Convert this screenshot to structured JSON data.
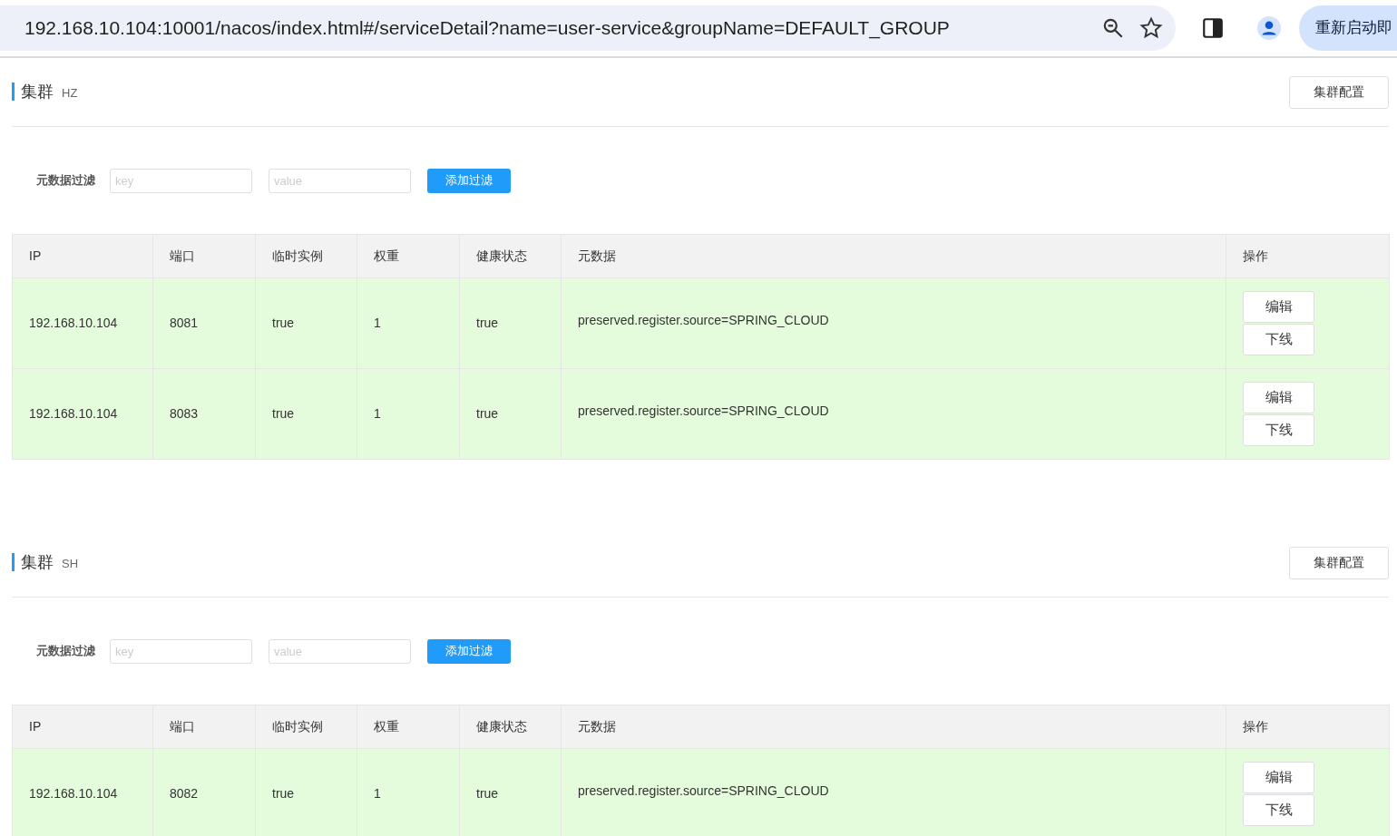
{
  "browser": {
    "url": "192.168.10.104:10001/nacos/index.html#/serviceDetail?name=user-service&groupName=DEFAULT_GROUP",
    "action_button": "重新启动即"
  },
  "clusters": [
    {
      "title": "集群",
      "name": "HZ",
      "config_button": "集群配置",
      "filter": {
        "label": "元数据过滤",
        "key_placeholder": "key",
        "value_placeholder": "value",
        "button": "添加过滤"
      },
      "columns": [
        "IP",
        "端口",
        "临时实例",
        "权重",
        "健康状态",
        "元数据",
        "操作"
      ],
      "rows": [
        {
          "ip": "192.168.10.104",
          "port": "8081",
          "ephemeral": "true",
          "weight": "1",
          "healthy": "true",
          "metadata": "preserved.register.source=SPRING_CLOUD",
          "actions": [
            "编辑",
            "下线"
          ]
        },
        {
          "ip": "192.168.10.104",
          "port": "8083",
          "ephemeral": "true",
          "weight": "1",
          "healthy": "true",
          "metadata": "preserved.register.source=SPRING_CLOUD",
          "actions": [
            "编辑",
            "下线"
          ]
        }
      ]
    },
    {
      "title": "集群",
      "name": "SH",
      "config_button": "集群配置",
      "filter": {
        "label": "元数据过滤",
        "key_placeholder": "key",
        "value_placeholder": "value",
        "button": "添加过滤"
      },
      "columns": [
        "IP",
        "端口",
        "临时实例",
        "权重",
        "健康状态",
        "元数据",
        "操作"
      ],
      "rows": [
        {
          "ip": "192.168.10.104",
          "port": "8082",
          "ephemeral": "true",
          "weight": "1",
          "healthy": "true",
          "metadata": "preserved.register.source=SPRING_CLOUD",
          "actions": [
            "编辑",
            "下线"
          ]
        }
      ]
    }
  ]
}
